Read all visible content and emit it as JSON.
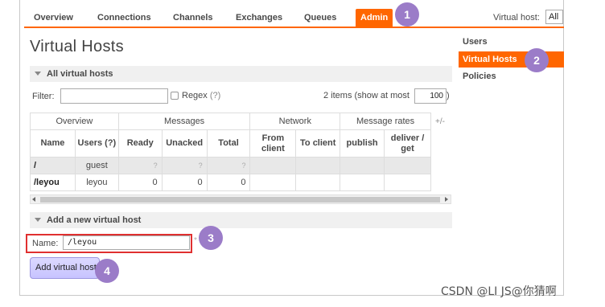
{
  "nav": {
    "tabs": [
      {
        "label": "Overview"
      },
      {
        "label": "Connections"
      },
      {
        "label": "Channels"
      },
      {
        "label": "Exchanges"
      },
      {
        "label": "Queues"
      },
      {
        "label": "Admin"
      }
    ],
    "virtual_host_label": "Virtual host:",
    "virtual_host_value": "All"
  },
  "page_title": "Virtual Hosts",
  "sidebar": {
    "items": [
      {
        "label": "Users"
      },
      {
        "label": "Virtual Hosts"
      },
      {
        "label": "Policies"
      }
    ]
  },
  "all_section": {
    "title": "All virtual hosts",
    "filter_label": "Filter:",
    "filter_value": "",
    "regex_label": "Regex",
    "regex_help": "(?)",
    "items_text": "2 items (show at most",
    "items_max": "100",
    "items_close": ")",
    "plus_minus": "+/-"
  },
  "table": {
    "groups": [
      "Overview",
      "Messages",
      "Network",
      "Message rates"
    ],
    "columns": [
      "Name",
      "Users (?)",
      "Ready",
      "Unacked",
      "Total",
      "From client",
      "To client",
      "publish",
      "deliver / get"
    ],
    "rows": [
      {
        "name": "/",
        "users": "guest",
        "ready": "?",
        "unacked": "?",
        "total": "?"
      },
      {
        "name": "/leyou",
        "users": "leyou",
        "ready": "0",
        "unacked": "0",
        "total": "0"
      }
    ]
  },
  "add_section": {
    "title": "Add a new virtual host",
    "name_label": "Name:",
    "name_value": "/leyou",
    "required_mark": "*",
    "button_label": "Add virtual host"
  },
  "annotations": [
    "1",
    "2",
    "3",
    "4"
  ],
  "watermark": "CSDN @LI JS@你猜啊",
  "colors": {
    "accent": "#ff6600",
    "badge": "#9b7cc8",
    "highlight": "#e03030",
    "button": "#c7c3ff"
  }
}
